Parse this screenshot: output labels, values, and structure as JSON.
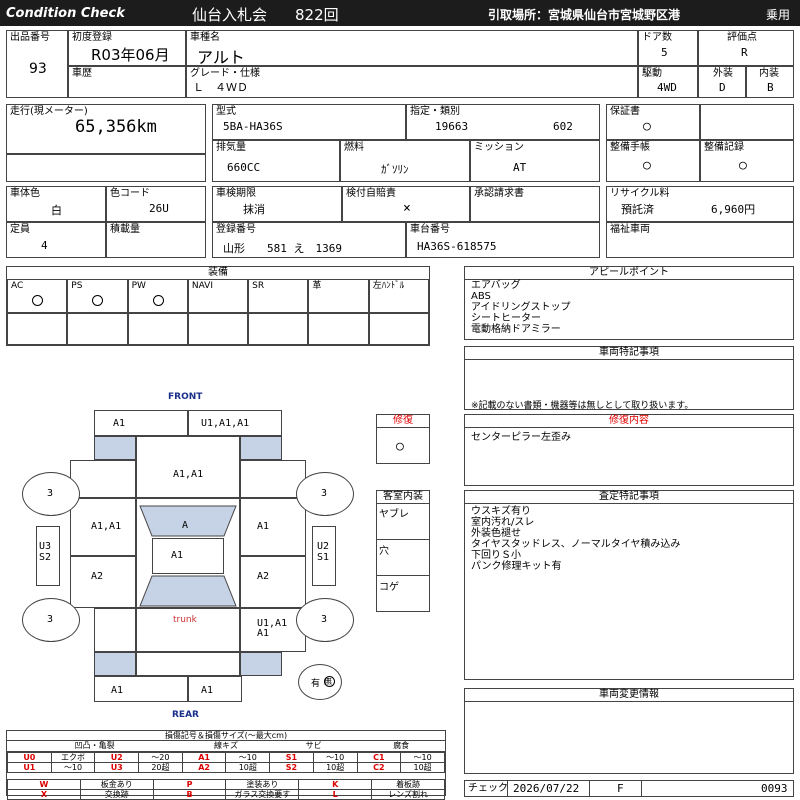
{
  "header": {
    "logo_text": "Condition  Check",
    "auction": "仙台入札会",
    "session": "822回",
    "pickup": "引取場所：宮城県仙台市宮城野区港",
    "category": "乗用"
  },
  "row1": {
    "lot_label": "出品番号",
    "lot": "93",
    "first_reg_label": "初度登録",
    "first_reg": "R03年06月",
    "car_name_label": "車種名",
    "car_name": "アルト",
    "doors_label": "ドア数",
    "doors": "5",
    "grade_label": "評価点",
    "grade": "R",
    "history_label": "車歴",
    "trim_label": "グレード・仕様",
    "trim": "Ｌ　４ＷＤ",
    "drive_label": "駆動",
    "drive": "4WD",
    "ext_label": "外装",
    "ext": "D",
    "int_label": "内装",
    "int": "B"
  },
  "row2": {
    "mileage_label": "走行(現メーター)",
    "mileage": "65,356km",
    "model_label": "型式",
    "model": "5BA-HA36S",
    "spec_label": "指定・類別",
    "spec": "19663",
    "class": "602",
    "warranty_label": "保証書",
    "warranty": "○",
    "disp_label": "排気量",
    "disp": "660CC",
    "fuel_label": "燃料",
    "fuel": "ｶﾞｿﾘﾝ",
    "mission_label": "ミッション",
    "mission": "AT",
    "manual_label": "整備手帳",
    "manual": "○",
    "record_label": "整備記録",
    "record": "○"
  },
  "row3": {
    "color_label": "車体色",
    "color": "白",
    "color_code_label": "色コード",
    "color_code": "26U",
    "inspection_label": "車検期限",
    "inspection": "抹消",
    "insurance_label": "検付自賠責",
    "insurance": "×",
    "approval_label": "承認請求書",
    "recycle_label": "リサイクル料",
    "recycle_status": "預託済",
    "recycle_fee": "6,960円",
    "capacity_label": "定員",
    "capacity": "4",
    "load_label": "積載量",
    "plate_label": "登録番号",
    "plate": "山形　　581 え　1369",
    "chassis_label": "車台番号",
    "chassis": "HA36S-618575",
    "welfare_label": "福祉車両"
  },
  "equipment": {
    "title": "装備",
    "cols": [
      "AC",
      "PS",
      "PW",
      "NAVI",
      "SR",
      "革",
      "左ﾊﾝﾄﾞﾙ"
    ],
    "marks": [
      "○",
      "○",
      "○",
      "",
      "",
      "",
      ""
    ]
  },
  "appeal": {
    "title": "アピールポイント",
    "lines": [
      "エアバッグ",
      "ABS",
      "アイドリングストップ",
      "シートヒーター",
      "電動格納ドアミラー"
    ]
  },
  "special": {
    "title": "車両特記事項",
    "note": "※記載のない書類・機器等は無しとして取り扱います。"
  },
  "repair": {
    "box_label": "修復",
    "box_mark": "○",
    "title": "修復内容",
    "content": "センターピラー左歪み"
  },
  "interior": {
    "title": "客室内装",
    "items": [
      "ヤブレ",
      "穴",
      "コゲ"
    ]
  },
  "assessment": {
    "title": "査定特記事項",
    "lines": [
      "ウスキズ有り",
      "室内汚れ/スレ",
      "外装色褪せ",
      "タイヤスタッドレス、ノーマルタイヤ積み込み",
      "下回りＳ小",
      "パンク修理キット有"
    ]
  },
  "changes": {
    "title": "車両変更情報"
  },
  "diagram": {
    "front": "FRONT",
    "rear": "REAR",
    "trunk": "trunk",
    "top_left": "A1",
    "top_right": "U1,A1,A1",
    "hood": "A1,A1",
    "left_front_door": "A1,A1",
    "windshield": "A",
    "right_front_door": "A1",
    "roof": "A1",
    "left_rear_door": "A2",
    "right_rear_door": "A2",
    "left_side": "U3\nS2",
    "right_side": "U2\nS1",
    "rear_right": "U1,A1\nA1",
    "bottom_left": "A1",
    "bottom_right": "A1",
    "tire_fl": "3",
    "tire_fr": "3",
    "tire_rl": "3",
    "tire_rr": "3",
    "spare": "有",
    "spare_mark": "無"
  },
  "legend": {
    "title": "損傷記号＆損傷サイズ(〜最大cm)",
    "groups": [
      "凹凸・亀裂",
      "線キズ",
      "サビ",
      "腐食"
    ],
    "rows": [
      [
        "U0",
        "エクボ",
        "U2",
        "〜20",
        "A1",
        "〜10",
        "S1",
        "〜10",
        "C1",
        "〜10"
      ],
      [
        "U1",
        "〜10",
        "U3",
        "20超",
        "A2",
        "10超",
        "S2",
        "10超",
        "C2",
        "10超"
      ]
    ],
    "rows2": [
      [
        "W",
        "板金あり",
        "P",
        "塗装あり",
        "K",
        "着板跡"
      ],
      [
        "X",
        "交換跡",
        "B",
        "ガラス交換要す",
        "L",
        "レンズ割れ"
      ]
    ]
  },
  "footer": {
    "check_label": "チェック",
    "date": "2026/07/22",
    "mark": "F",
    "number": "0093"
  }
}
